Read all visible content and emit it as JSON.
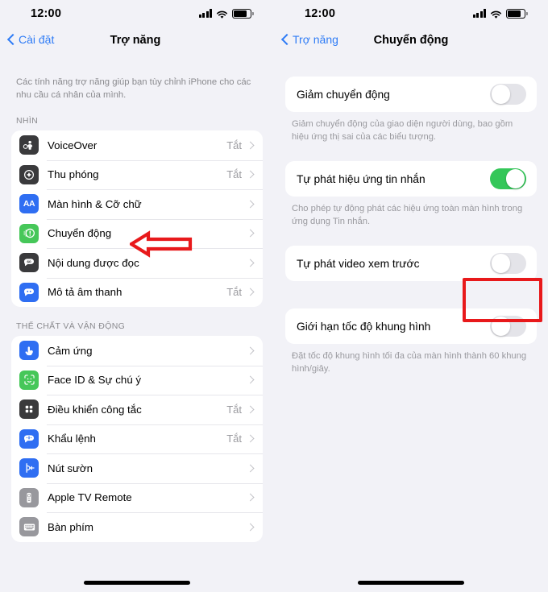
{
  "status_bar": {
    "time": "12:00",
    "cellular_icon": "cellular-bars-icon",
    "wifi_icon": "wifi-icon",
    "battery_icon": "battery-icon"
  },
  "left_screen": {
    "nav": {
      "back_label": "Cài đặt",
      "back_icon": "chevron-left-icon",
      "title": "Trợ năng"
    },
    "intro_text": "Các tính năng trợ năng giúp bạn tùy chỉnh iPhone cho các nhu cầu cá nhân của mình.",
    "sections": [
      {
        "header": "NHÌN",
        "items": [
          {
            "label": "VoiceOver",
            "value": "Tắt",
            "icon": "voiceover-icon",
            "icon_color": "#3a3a3c"
          },
          {
            "label": "Thu phóng",
            "value": "Tắt",
            "icon": "zoom-icon",
            "icon_color": "#3a3a3c"
          },
          {
            "label": "Màn hình & Cỡ chữ",
            "value": "",
            "icon": "display-text-size-icon",
            "icon_color": "#2f6ef2"
          },
          {
            "label": "Chuyển động",
            "value": "",
            "icon": "motion-icon",
            "icon_color": "#46c759"
          },
          {
            "label": "Nội dung được đọc",
            "value": "",
            "icon": "spoken-content-icon",
            "icon_color": "#3a3a3c"
          },
          {
            "label": "Mô tả âm thanh",
            "value": "Tắt",
            "icon": "audio-descriptions-icon",
            "icon_color": "#2f6ef2"
          }
        ]
      },
      {
        "header": "THỂ CHẤT VÀ VẬN ĐỘNG",
        "items": [
          {
            "label": "Cảm ứng",
            "value": "",
            "icon": "touch-icon",
            "icon_color": "#2f6ef2"
          },
          {
            "label": "Face ID & Sự chú ý",
            "value": "",
            "icon": "face-id-icon",
            "icon_color": "#46c759"
          },
          {
            "label": "Điều khiển công tắc",
            "value": "Tắt",
            "icon": "switch-control-icon",
            "icon_color": "#3a3a3c"
          },
          {
            "label": "Khẩu lệnh",
            "value": "Tắt",
            "icon": "voice-control-icon",
            "icon_color": "#2f6ef2"
          },
          {
            "label": "Nút sườn",
            "value": "",
            "icon": "side-button-icon",
            "icon_color": "#2f6ef2"
          },
          {
            "label": "Apple TV Remote",
            "value": "",
            "icon": "apple-tv-remote-icon",
            "icon_color": "#98989d"
          },
          {
            "label": "Bàn phím",
            "value": "",
            "icon": "keyboard-icon",
            "icon_color": "#98989d"
          }
        ]
      }
    ]
  },
  "right_screen": {
    "nav": {
      "back_label": "Trợ năng",
      "back_icon": "chevron-left-icon",
      "title": "Chuyển động"
    },
    "settings": [
      {
        "label": "Giảm chuyển động",
        "state": "off",
        "footnote": "Giảm chuyển động của giao diện người dùng, bao gồm hiệu ứng thị sai của các biểu tượng."
      },
      {
        "label": "Tự phát hiệu ứng tin nhắn",
        "state": "on",
        "footnote": "Cho phép tự động phát các hiệu ứng toàn màn hình trong ứng dụng Tin nhắn."
      },
      {
        "label": "Tự phát video xem trước",
        "state": "off",
        "footnote": ""
      },
      {
        "label": "Giới hạn tốc độ khung hình",
        "state": "off",
        "footnote": "Đặt tốc độ khung hình tối đa của màn hình thành 60 khung hình/giây."
      }
    ]
  },
  "annotations": {
    "arrow": {
      "name": "red-arrow-pointing-left",
      "color": "#e8191b"
    },
    "box": {
      "name": "red-highlight-box",
      "color": "#e8191b"
    }
  },
  "theme": {
    "background": "#f2f2f7",
    "card": "#ffffff",
    "accent_blue": "#2f7cf6",
    "toggle_on": "#34c759",
    "toggle_off": "#e4e4e9",
    "secondary_text": "#8a8a8e"
  }
}
